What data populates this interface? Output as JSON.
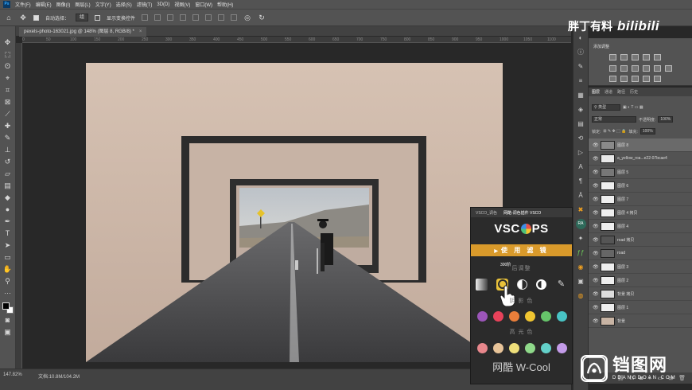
{
  "menubar": {
    "items": [
      "文件(F)",
      "编辑(E)",
      "图像(I)",
      "图层(L)",
      "文字(Y)",
      "选择(S)",
      "滤镜(T)",
      "3D(D)",
      "视图(V)",
      "窗口(W)",
      "帮助(H)"
    ]
  },
  "options": {
    "auto_select_label": "自动选择：",
    "group_value": "组",
    "show_transform_label": "显示变换控件"
  },
  "document": {
    "tab_title": "pexels-photo-163021.jpg @ 148% (图层 8, RGB/8) *",
    "zoom": "147.82%",
    "doc_info": "文档:10.8M/104.2M"
  },
  "ruler": {
    "ticks": [
      "0",
      "50",
      "100",
      "150",
      "200",
      "250",
      "300",
      "350",
      "400",
      "450",
      "500",
      "550",
      "600",
      "650",
      "700",
      "750",
      "800",
      "850",
      "900",
      "950",
      "1000",
      "1050",
      "1100"
    ]
  },
  "brand": {
    "channel_name": "胖丁有料",
    "site_logo": "bilibili"
  },
  "vsco_panel": {
    "tabs": [
      "VSCO_调色",
      "网酷-调色插件 VSCO"
    ],
    "logo_left": "VSC",
    "logo_right": "PS",
    "use_filter_label": "使 用 滤 镜",
    "tooltip": "300阶",
    "adjust_label": "后调整",
    "shadow_label": "阴 影 色",
    "highlight_label": "高 光 色",
    "footer": "网酷 W-Cool",
    "shadow_colors": [
      "#9b55b8",
      "#e8425a",
      "#e97e3a",
      "#f0c531",
      "#66c46a",
      "#48c3c4"
    ],
    "highlight_colors": [
      "#e8878c",
      "#e8c499",
      "#eedf7a",
      "#8fd98a",
      "#63d0c9",
      "#c39be8"
    ]
  },
  "adjustments_panel": {
    "title": "添加调整"
  },
  "layers_panel": {
    "tabs": [
      "图层",
      "通道",
      "路径",
      "历史"
    ],
    "kind_filter": "类型",
    "blend_mode": "正常",
    "opacity_label": "不透明度:",
    "opacity_value": "100%",
    "lock_label": "锁定:",
    "fill_label": "填充:",
    "fill_value": "100%",
    "layers": [
      {
        "name": "图层 8",
        "selected": true,
        "thumb": "#8a8a8a"
      },
      {
        "name": "a_yellow_roa...e22-07bcae4",
        "selected": false,
        "thumb": "#e8e8e8"
      },
      {
        "name": "图层 5",
        "selected": false,
        "thumb": "#777777"
      },
      {
        "name": "图层 6",
        "selected": false,
        "thumb": "#eeeeee"
      },
      {
        "name": "图层 7",
        "selected": false,
        "thumb": "#eeeeee"
      },
      {
        "name": "图层 4 拷贝",
        "selected": false,
        "thumb": "#eeeeee"
      },
      {
        "name": "图层 4",
        "selected": false,
        "thumb": "#eeeeee"
      },
      {
        "name": "road 拷贝",
        "selected": false,
        "thumb": "#555555"
      },
      {
        "name": "road",
        "selected": false,
        "thumb": "#666666"
      },
      {
        "name": "图层 3",
        "selected": false,
        "thumb": "#eeeeee"
      },
      {
        "name": "图层 2",
        "selected": false,
        "thumb": "#eeeeee"
      },
      {
        "name": "背景 拷贝",
        "selected": false,
        "thumb": "#dcdcdc"
      },
      {
        "name": "图层 1",
        "selected": false,
        "thumb": "#eeeeee"
      },
      {
        "name": "背景",
        "selected": false,
        "thumb": "#c8b4a4"
      }
    ]
  },
  "watermark": {
    "title": "铛图网",
    "subtitle": "DDANGDOAN.COM"
  }
}
